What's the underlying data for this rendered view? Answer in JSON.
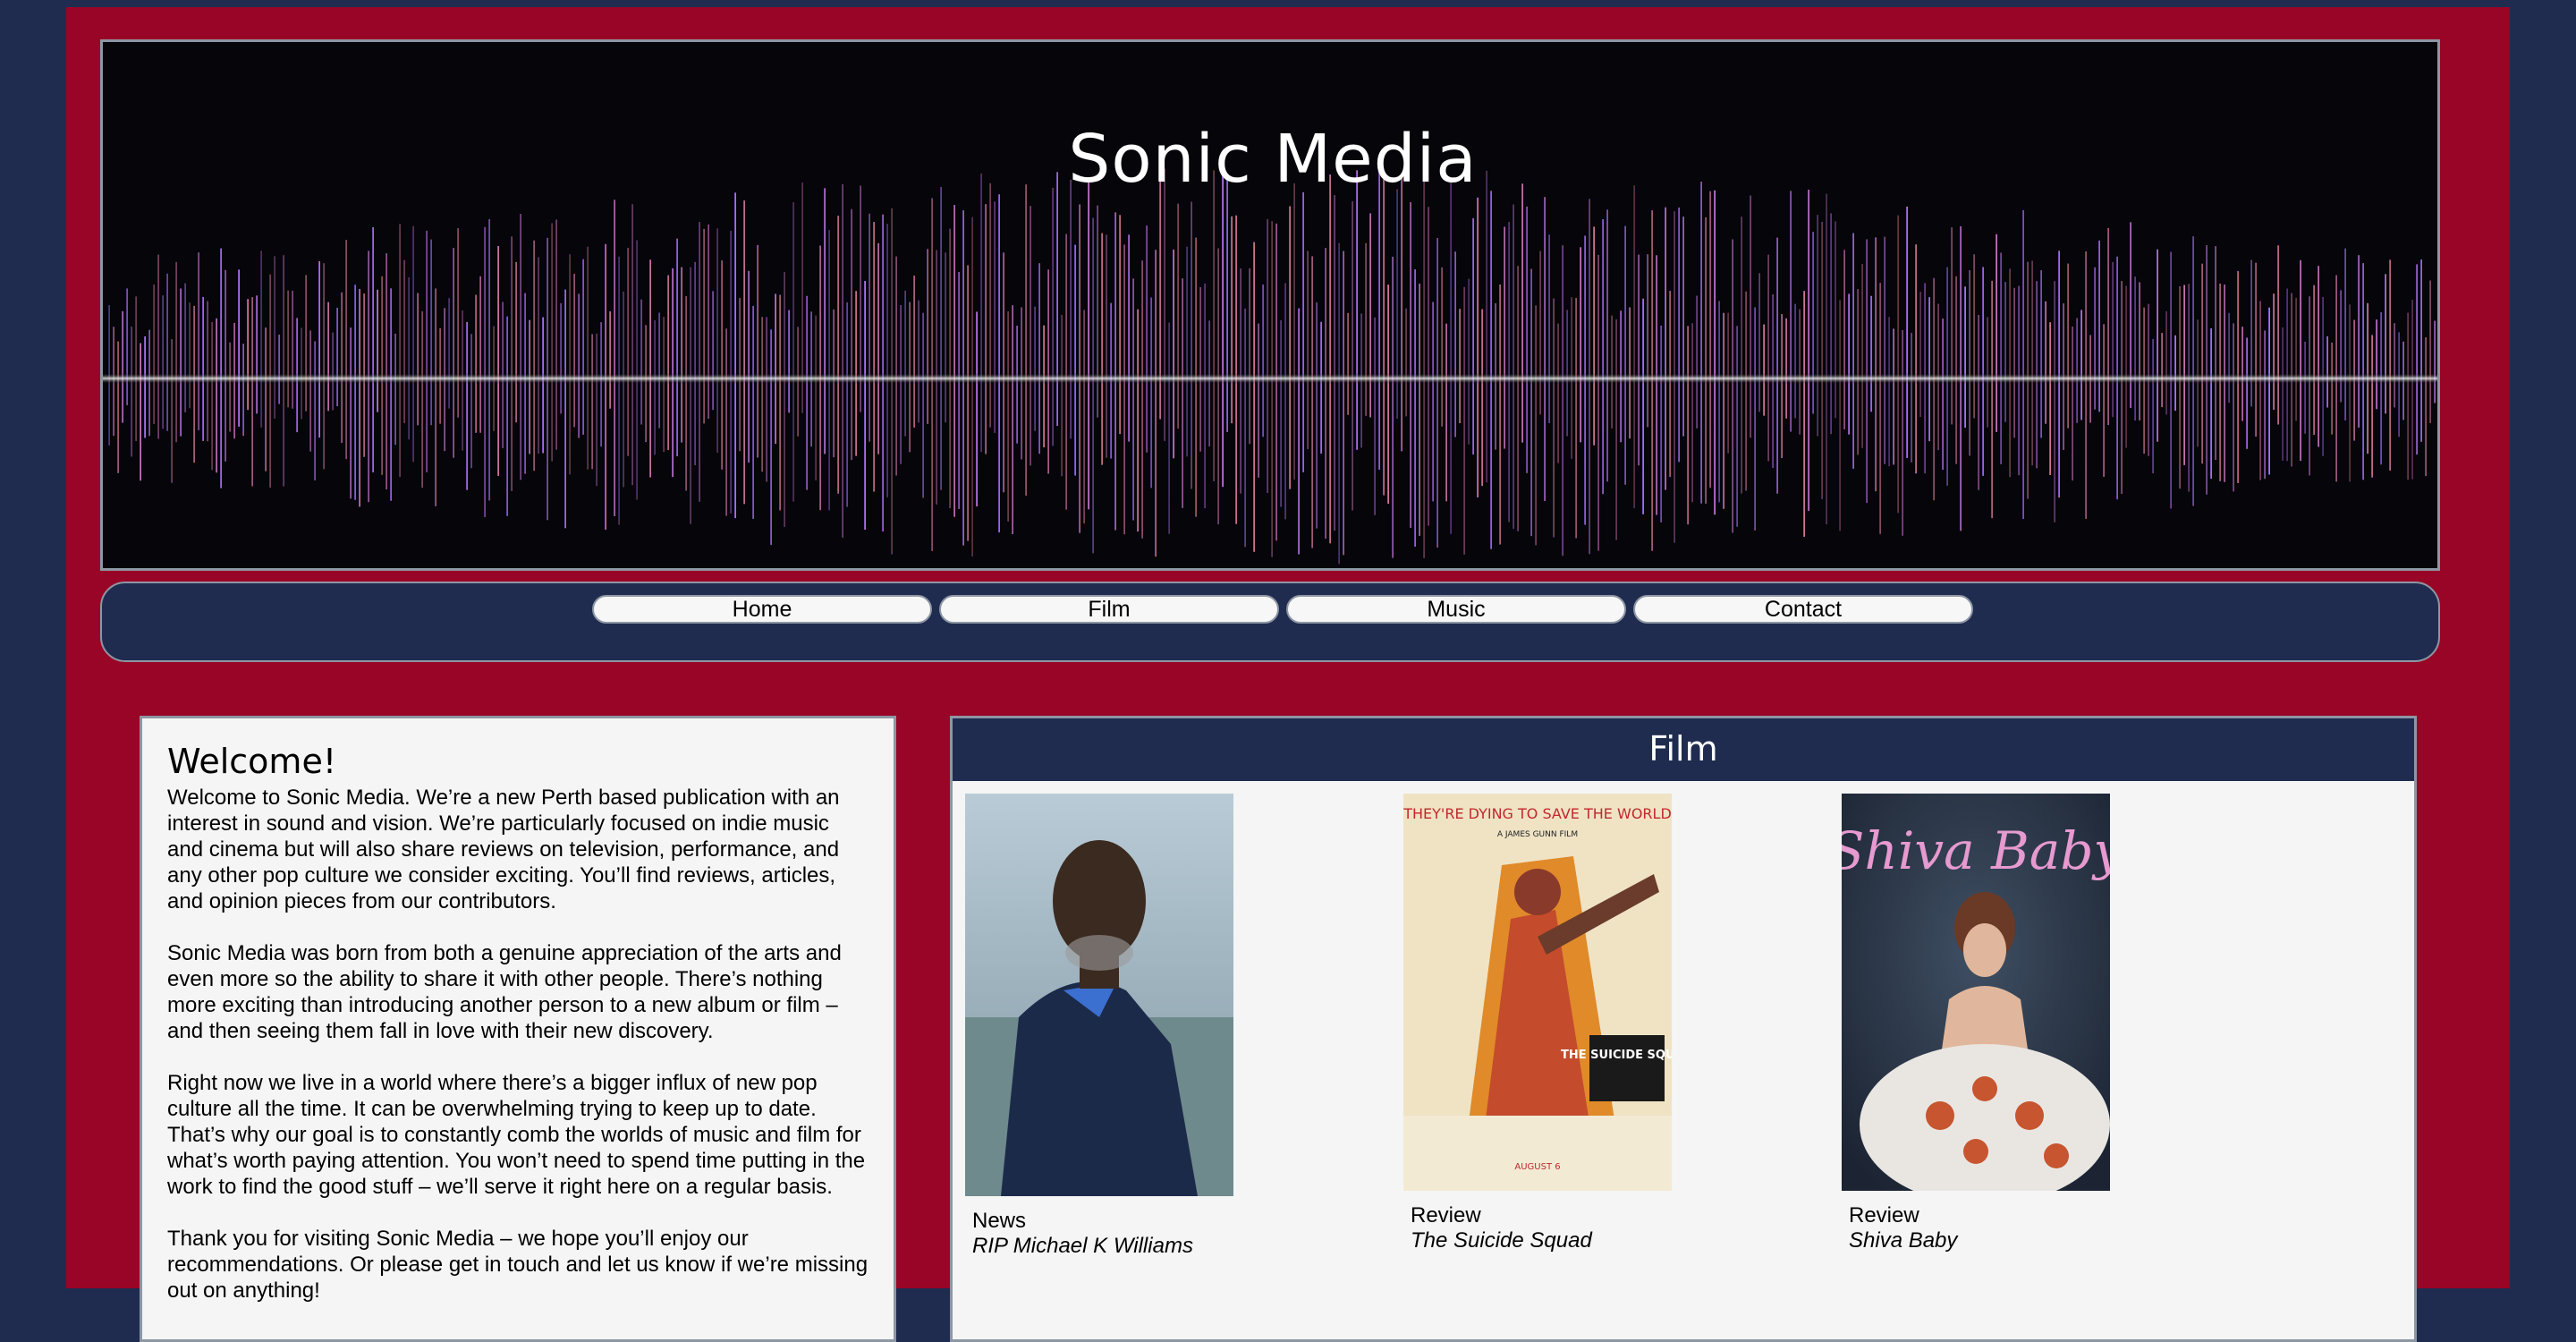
{
  "site": {
    "title": "Sonic Media"
  },
  "nav": {
    "items": [
      "Home",
      "Film",
      "Music",
      "Contact"
    ]
  },
  "welcome": {
    "heading": "Welcome!",
    "paragraphs": [
      "Welcome to Sonic Media. We’re a new Perth based publication with an interest in sound and vision. We’re particularly focused on indie music and cinema but will also share reviews on television, performance, and any other pop culture we consider exciting. You’ll find reviews, articles, and opinion pieces from our contributors.",
      "Sonic Media was born from both a genuine appreciation of the arts and even more so the ability to share it with other people. There’s nothing more exciting than introducing another person to a new album or film – and then seeing them fall in love with their new discovery.",
      "Right now we live in a world where there’s a bigger influx of new pop culture all the time. It can be overwhelming trying to keep up to date. That’s why our goal is to constantly comb the worlds of music and film for what’s worth paying attention. You won’t need to spend time putting in the work to find the good stuff – we’ll serve it right here on a regular basis.",
      "Thank you for visiting Sonic Media – we hope you’ll enjoy our recommendations. Or please get in touch and let us know if we’re missing out on anything!"
    ]
  },
  "film": {
    "heading": "Film",
    "cards": [
      {
        "category": "News",
        "title": "RIP Michael K Williams"
      },
      {
        "category": "Review",
        "title": "The Suicide Squad"
      },
      {
        "category": "Review",
        "title": "Shiva Baby"
      }
    ],
    "poster_suicide_squad": {
      "tagline": "THEY'RE DYING TO SAVE THE WORLD",
      "credit": "A JAMES GUNN FILM",
      "logo": "THE SUICIDE SQUAD",
      "date": "AUGUST 6"
    },
    "poster_shiva_baby": {
      "script_title": "Shiva Baby"
    }
  },
  "colors": {
    "outer_bg": "#1f2c50",
    "page_bg": "#990526",
    "panel_bg": "#f5f5f5",
    "border": "#8d96a3"
  }
}
